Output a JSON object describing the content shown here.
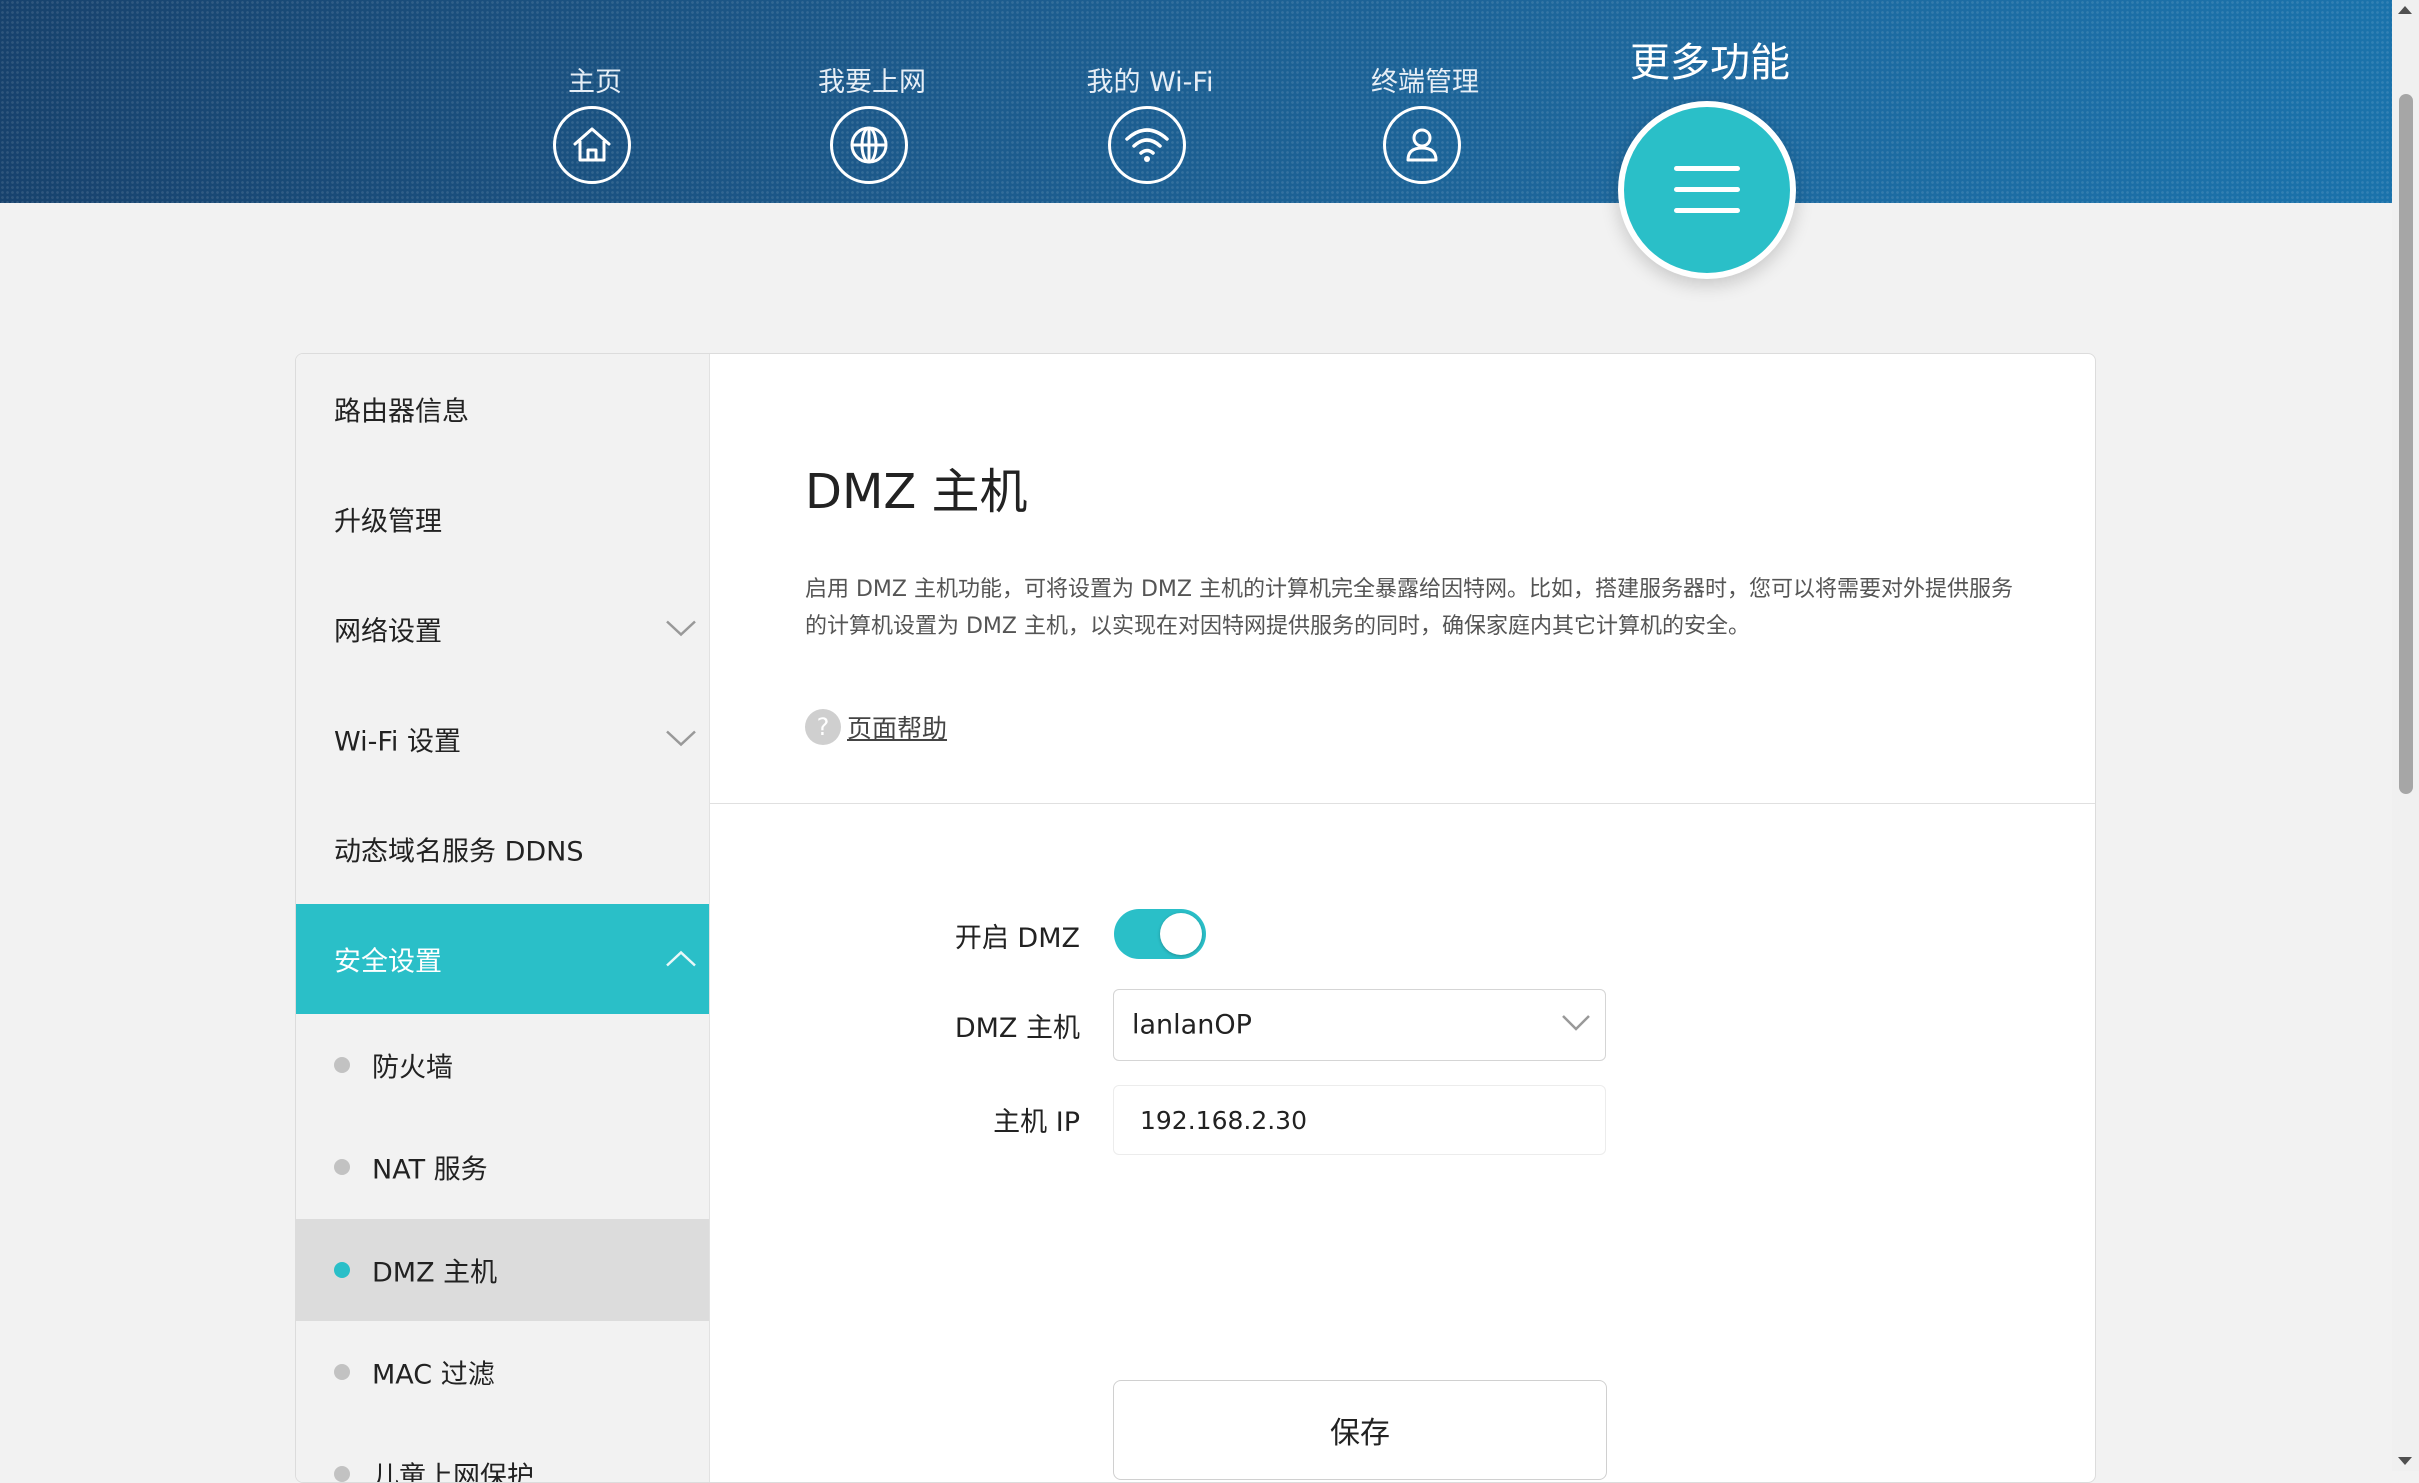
{
  "nav": {
    "items": [
      {
        "label": "主页",
        "icon": "home-icon"
      },
      {
        "label": "我要上网",
        "icon": "globe-icon"
      },
      {
        "label": "我的 Wi-Fi",
        "icon": "wifi-icon"
      },
      {
        "label": "终端管理",
        "icon": "user-icon"
      }
    ],
    "active": {
      "label": "更多功能",
      "icon": "menu-icon"
    }
  },
  "sidebar": {
    "items": [
      {
        "label": "路由器信息"
      },
      {
        "label": "升级管理"
      },
      {
        "label": "网络设置"
      },
      {
        "label": "Wi-Fi 设置"
      },
      {
        "label": "动态域名服务 DDNS"
      },
      {
        "label": "安全设置"
      }
    ],
    "subitems": [
      {
        "label": "防火墙"
      },
      {
        "label": "NAT 服务"
      },
      {
        "label": "DMZ 主机"
      },
      {
        "label": "MAC 过滤"
      },
      {
        "label": "儿童上网保护"
      }
    ]
  },
  "main": {
    "title": "DMZ 主机",
    "description": "启用 DMZ 主机功能，可将设置为 DMZ 主机的计算机完全暴露给因特网。比如，搭建服务器时，您可以将需要对外提供服务的计算机设置为 DMZ 主机，以实现在对因特网提供服务的同时，确保家庭内其它计算机的安全。",
    "help_icon": "?",
    "help_link": "页面帮助",
    "form": {
      "enable_label": "开启 DMZ",
      "enabled": true,
      "host_label": "DMZ 主机",
      "host_value": "lanlanOP",
      "ip_label": "主机 IP",
      "ip_value": "192.168.2.30"
    },
    "save_label": "保存"
  },
  "colors": {
    "accent": "#2abfc8",
    "header": "#1c5b8d"
  }
}
